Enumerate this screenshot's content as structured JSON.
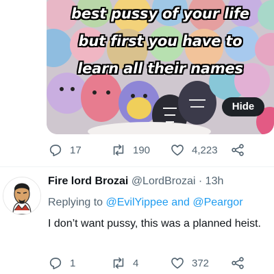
{
  "media": {
    "caption_lines": [
      "best pussy of your life",
      "but first you have to",
      "learn all their names"
    ],
    "hide_label": "Hide"
  },
  "tweet_actions": {
    "reply_count": "17",
    "retweet_count": "190",
    "like_count": "4,223"
  },
  "reply": {
    "name": "Fire lord Brozai",
    "handle": "@LordBrozai",
    "separator": "·",
    "time": "13h",
    "replying_to_prefix": "Replying to",
    "mention1": "@EvilYippee",
    "conjunction": "and",
    "mention2": "@Peargor",
    "text": "I don’t want pussy, this was a planned heist.",
    "actions": {
      "reply_count": "1",
      "retweet_count": "4",
      "like_count": "372"
    }
  },
  "colors": {
    "accent": "#1d9bf0",
    "secondary_text": "#536471",
    "primary_text": "#0f1419"
  },
  "icons": [
    "reply-icon",
    "retweet-icon",
    "like-icon",
    "share-icon"
  ]
}
